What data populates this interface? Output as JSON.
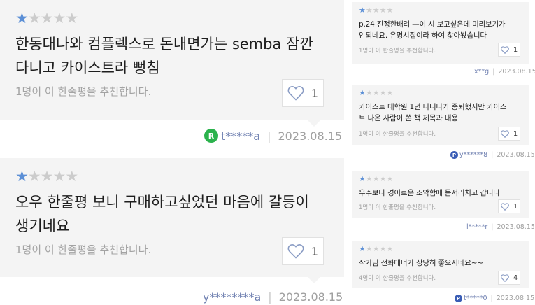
{
  "reviews_main": [
    {
      "stars": 1,
      "text_line1": "한동대나와 컴플렉스로 돈내면가는 semba 잠깐",
      "text_line2": "다니고 카이스트라 뻥침",
      "recommend_text": "1명이 이 한줄평을 추천합니다.",
      "likes": "1",
      "user_badge": "R",
      "user": "t*****a",
      "date": "2023.08.15"
    },
    {
      "stars": 1,
      "text_line1": "오우 한줄평 보니 구매하고싶었던 마음에 갈등이",
      "text_line2": "생기네요",
      "recommend_text": "1명이 이 한줄평을 추천합니다.",
      "likes": "1",
      "user": "y********a",
      "date": "2023.08.15"
    }
  ],
  "reviews_side": [
    {
      "stars": 1,
      "text_line1": "p.24 진정한배려 —이 시 보고싶은데 미리보기가",
      "text_line2": "안되네요. 유명시집이라 하여 찾아봤습니다",
      "recommend_text": "1명이 이 한줄평을 추천합니다.",
      "likes": "1",
      "user": "x**g",
      "date": "2023.08.15"
    },
    {
      "stars": 1,
      "text_line1": "카이스트 대학원 1년 다니다가 중퇴했지만 카이스",
      "text_line2": "트 나온 사람이 쓴 책 제목과 내용",
      "recommend_text": "1명이 이 한줄평을 추천합니다.",
      "likes": "1",
      "user_badge": "P",
      "user": "y******8",
      "date": "2023.08.15"
    },
    {
      "stars": 1,
      "text_line1": "우주보다 경이로운 조악함에 몸서리치고 갑니다",
      "text_line2": "",
      "recommend_text": "1명이 이 한줄평을 추천합니다.",
      "likes": "1",
      "user": "l*****r",
      "date": "2023.08.15"
    },
    {
      "stars": 1,
      "text_line1": "작가님 전화매너가 상당히 좋으시네요~~",
      "text_line2": "",
      "recommend_text": "4명이 이 한줄평을 추천합니다.",
      "likes": "4",
      "user_badge": "P",
      "user": "t*****0",
      "date": "2023.08.15"
    }
  ],
  "icons": {
    "star": "star-icon",
    "like": "heart-icon",
    "badge": "user-badge-icon"
  },
  "colors": {
    "star_on": "#5b8fd6",
    "star_off": "#cccccc",
    "badge_green": "#2bb24c",
    "badge_blue": "#3a5db5"
  }
}
